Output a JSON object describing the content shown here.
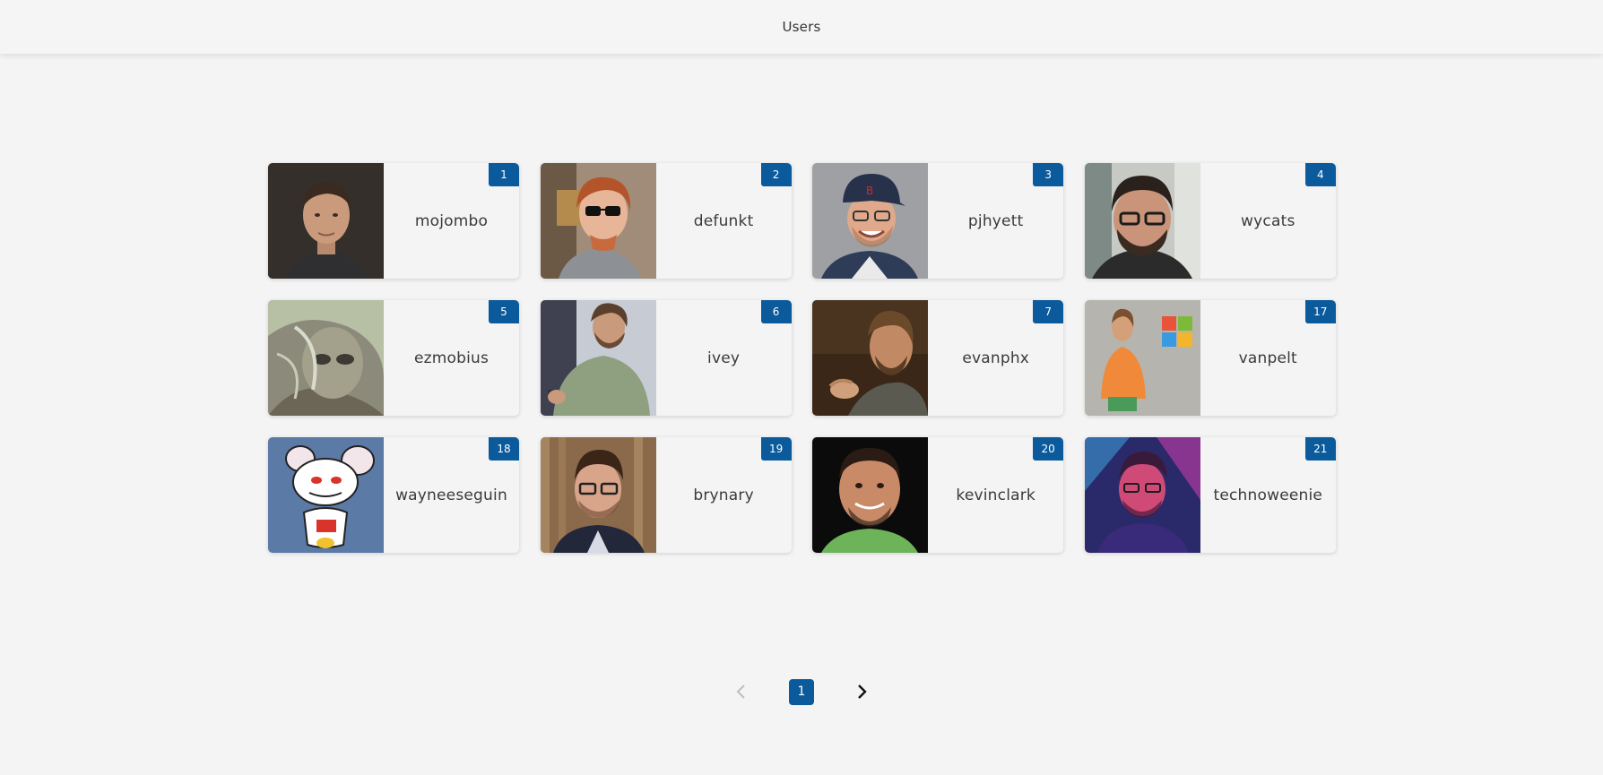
{
  "header": {
    "title": "Users"
  },
  "users": [
    {
      "id": "1",
      "login": "mojombo",
      "avatar": "portrait-man-dark-background"
    },
    {
      "id": "2",
      "login": "defunkt",
      "avatar": "portrait-man-sunglasses"
    },
    {
      "id": "3",
      "login": "pjhyett",
      "avatar": "portrait-man-cap-glasses"
    },
    {
      "id": "4",
      "login": "wycats",
      "avatar": "portrait-man-glasses-beard"
    },
    {
      "id": "5",
      "login": "ezmobius",
      "avatar": "abstract-alien-art"
    },
    {
      "id": "6",
      "login": "ivey",
      "avatar": "portrait-man-green-sweater"
    },
    {
      "id": "7",
      "login": "evanphx",
      "avatar": "portrait-man-speaking"
    },
    {
      "id": "17",
      "login": "vanpelt",
      "avatar": "portrait-man-orange-shirt"
    },
    {
      "id": "18",
      "login": "wayneeseguin",
      "avatar": "cartoon-mouse"
    },
    {
      "id": "19",
      "login": "brynary",
      "avatar": "portrait-man-glasses-wood"
    },
    {
      "id": "20",
      "login": "kevinclark",
      "avatar": "portrait-man-smiling-dark"
    },
    {
      "id": "21",
      "login": "technoweenie",
      "avatar": "portrait-man-neon-lights"
    }
  ],
  "pagination": {
    "current_page": "1",
    "prev_icon": "chevron-left-icon",
    "next_icon": "chevron-right-icon"
  },
  "colors": {
    "accent": "#0a5a9c",
    "background": "#f4f4f4"
  }
}
